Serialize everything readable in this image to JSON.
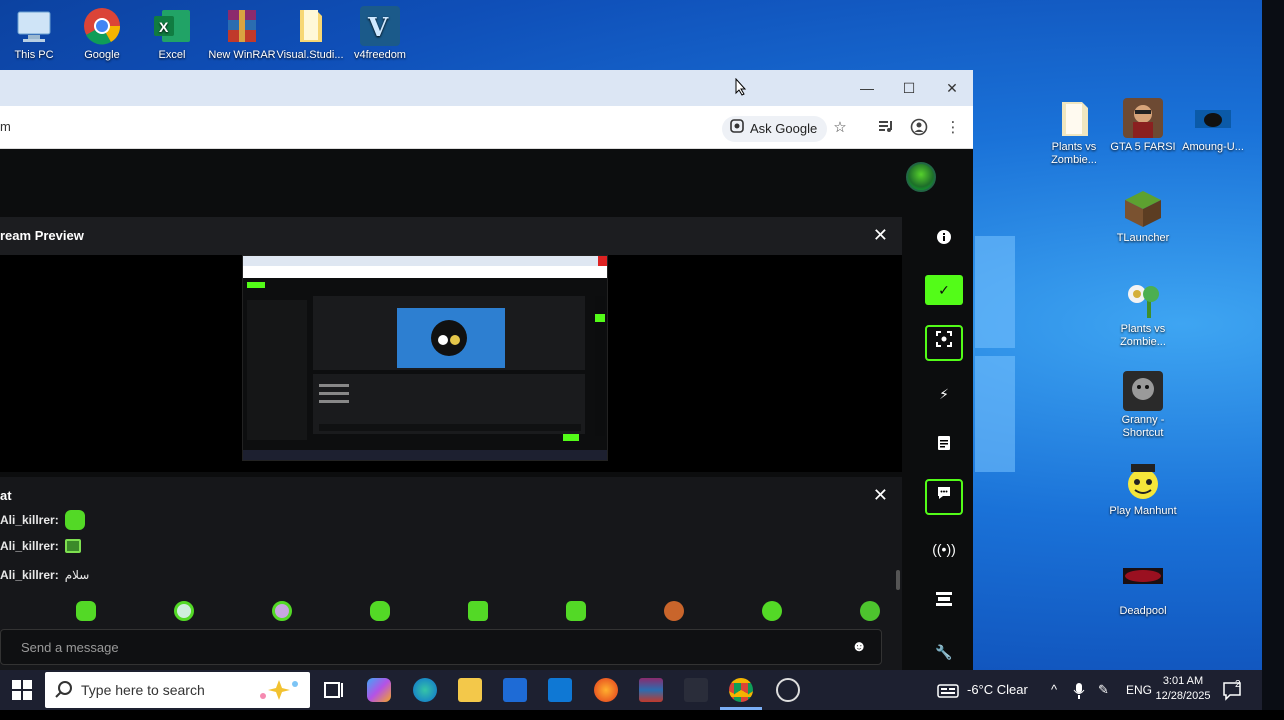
{
  "desktop": {
    "top_icons": [
      {
        "label": "This PC",
        "icon": "computer-icon"
      },
      {
        "label": "Google",
        "icon": "chrome-icon"
      },
      {
        "label": "Excel",
        "icon": "excel-icon"
      },
      {
        "label": "New WinRAR",
        "icon": "winrar-icon"
      },
      {
        "label": "Visual.Studi...",
        "icon": "folder-icon"
      },
      {
        "label": "v4freedom",
        "icon": "v4freedom-icon"
      }
    ],
    "right_icons": [
      {
        "label": "Plants vs Zombie...",
        "icon": "folder-icon"
      },
      {
        "label": "GTA 5 FARSI",
        "icon": "gta-icon"
      },
      {
        "label": "Amoung-U...",
        "icon": "among-us-icon"
      },
      {
        "label": "TLauncher",
        "icon": "minecraft-icon"
      },
      {
        "label": "Plants vs Zombie...",
        "icon": "plants-vs-zombies-icon"
      },
      {
        "label": "Granny - Shortcut",
        "icon": "granny-icon"
      },
      {
        "label": "Play Manhunt",
        "icon": "manhunt-icon"
      },
      {
        "label": "Deadpool",
        "icon": "deadpool-icon"
      }
    ]
  },
  "browser": {
    "url_fragment": "m",
    "ask_google_label": "Ask Google",
    "window_controls": {
      "minimize": "—",
      "maximize": "☐",
      "close": "✕"
    }
  },
  "kick": {
    "stream_preview": {
      "title": "ream Preview",
      "close": "✕"
    },
    "chat": {
      "title": "at",
      "close": "✕",
      "messages": [
        {
          "user": "Ali_killrer:",
          "text": "",
          "emote": "green-blob-emote"
        },
        {
          "user": "Ali_killrer:",
          "text": "",
          "emote": "green-frame-emote"
        },
        {
          "user": "Ali_killrer:",
          "text": "سلام",
          "emote": ""
        }
      ],
      "placeholder": "Send a message",
      "emoji_button": "☻"
    },
    "accent_color": "#53fc18"
  },
  "taskbar": {
    "search_placeholder": "Type here to search",
    "weather": "-6°C  Clear",
    "language": "ENG",
    "time": "3:01 AM",
    "date": "12/28/2025",
    "notification_count": "2"
  }
}
